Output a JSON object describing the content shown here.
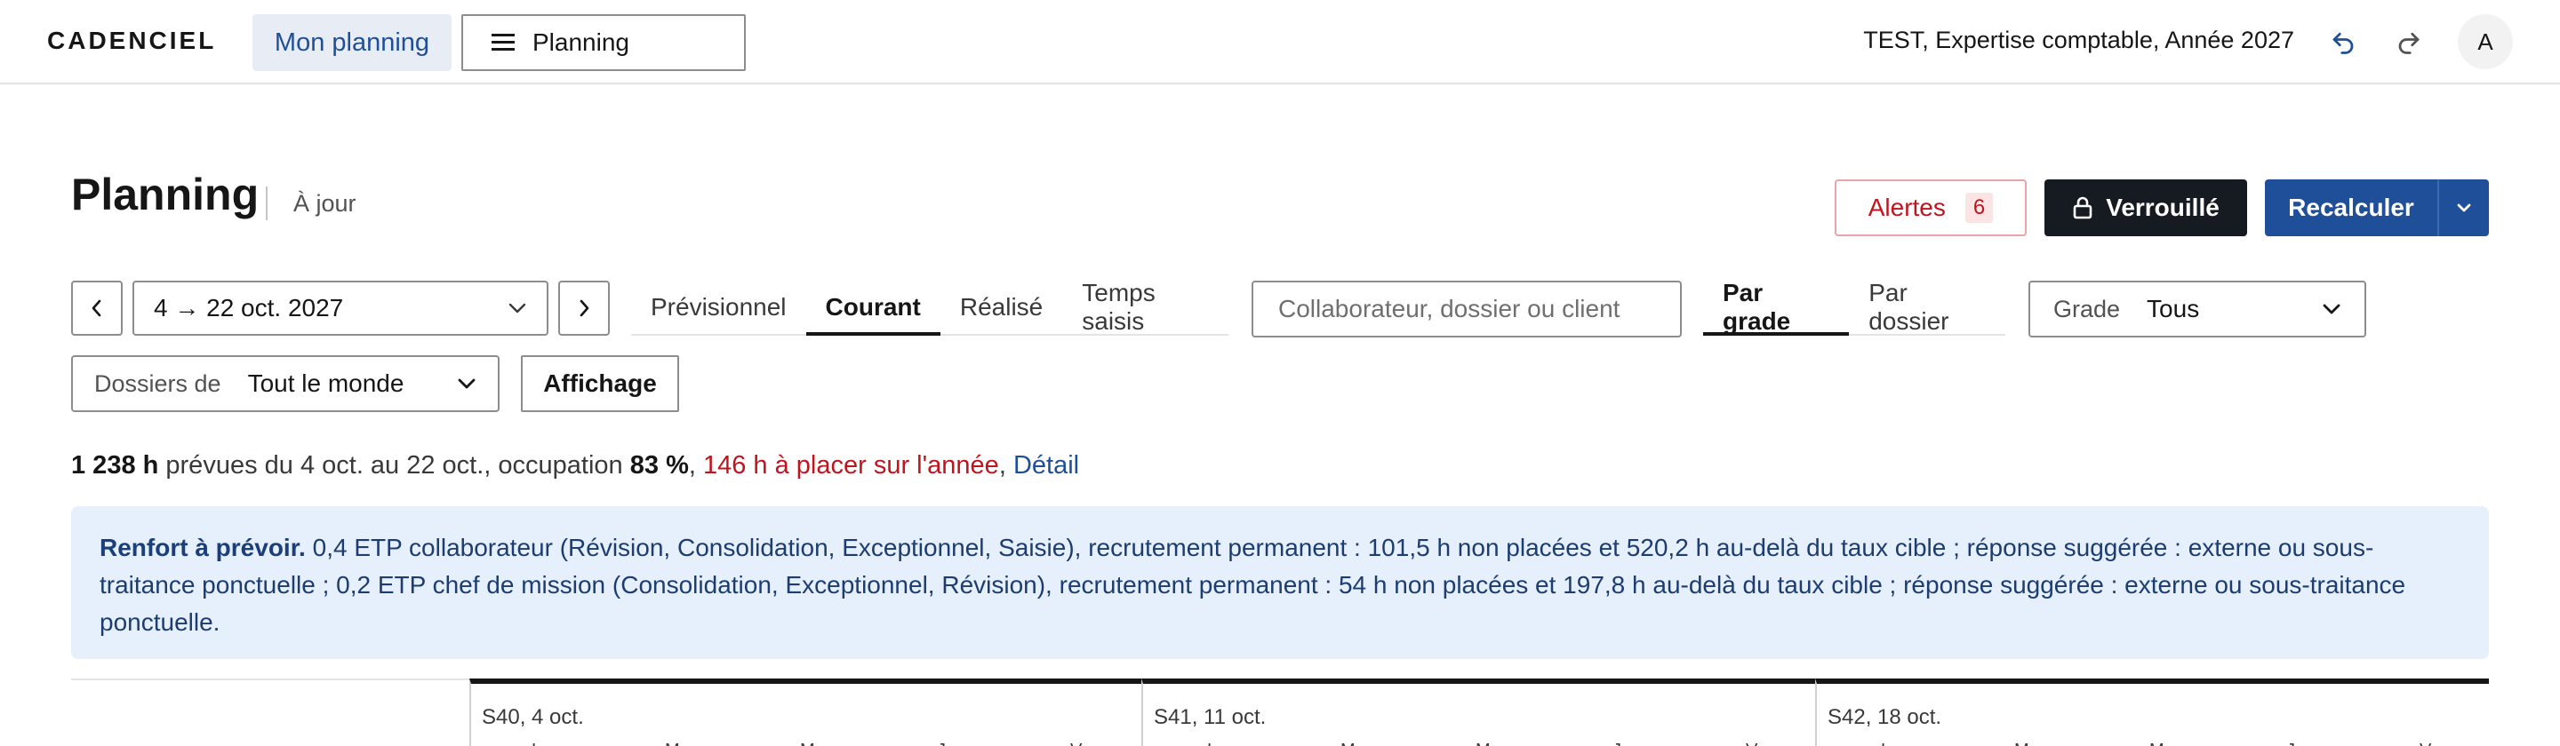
{
  "topbar": {
    "brand": "CADENCIEL",
    "nav_active": "Mon planning",
    "nav_menu": "Planning",
    "context": "TEST, Expertise comptable, Année 2027",
    "avatar": "A"
  },
  "header": {
    "title": "Planning",
    "status": "À jour",
    "alerts_label": "Alertes",
    "alerts_count": "6",
    "lock_label": "Verrouillé",
    "recalc_label": "Recalculer"
  },
  "filters": {
    "date_range": "4 → 22 oct. 2027",
    "view_tabs": [
      "Prévisionnel",
      "Courant",
      "Réalisé",
      "Temps saisis"
    ],
    "view_active": "Courant",
    "search_placeholder": "Collaborateur, dossier ou client",
    "group_tabs": [
      "Par grade",
      "Par dossier"
    ],
    "group_active": "Par grade",
    "grade_label": "Grade",
    "grade_value": "Tous",
    "owner_label": "Dossiers de",
    "owner_value": "Tout le monde",
    "display_label": "Affichage"
  },
  "summary": {
    "hours": "1 238 h",
    "planned_text": " prévues du 4 oct. au 22 oct., occupation ",
    "occupation": "83 %",
    "sep1": ", ",
    "to_place": "146 h à placer sur l'année",
    "sep2": ", ",
    "detail_link": "Détail"
  },
  "banner": {
    "title": "Renfort à prévoir.",
    "text": " 0,4 ETP collaborateur (Révision, Consolidation, Exceptionnel, Saisie), recrutement permanent : 101,5 h non placées et 520,2 h au-delà du taux cible ; réponse suggérée : externe ou sous-traitance ponctuelle ; 0,2 ETP chef de mission (Consolidation, Exceptionnel, Révision), recrutement permanent : 54 h non placées et 197,8 h au-delà du taux cible ; réponse suggérée : externe ou sous-traitance ponctuelle."
  },
  "timeline": {
    "weeks": [
      {
        "label": "S40, 4 oct.",
        "days": [
          "L",
          "M",
          "M",
          "J",
          "V"
        ]
      },
      {
        "label": "S41, 11 oct.",
        "days": [
          "L",
          "M",
          "M",
          "J",
          "V"
        ]
      },
      {
        "label": "S42, 18 oct.",
        "days": [
          "L",
          "M",
          "M",
          "J",
          "V"
        ]
      }
    ]
  },
  "icons": {
    "undo": "undo-icon",
    "redo": "redo-icon",
    "menu": "hamburger-icon",
    "lock": "lock-icon"
  },
  "colors": {
    "primary": "#1f4f99",
    "danger": "#c0141e",
    "dark": "#161a21",
    "banner_bg": "#e6effc"
  }
}
